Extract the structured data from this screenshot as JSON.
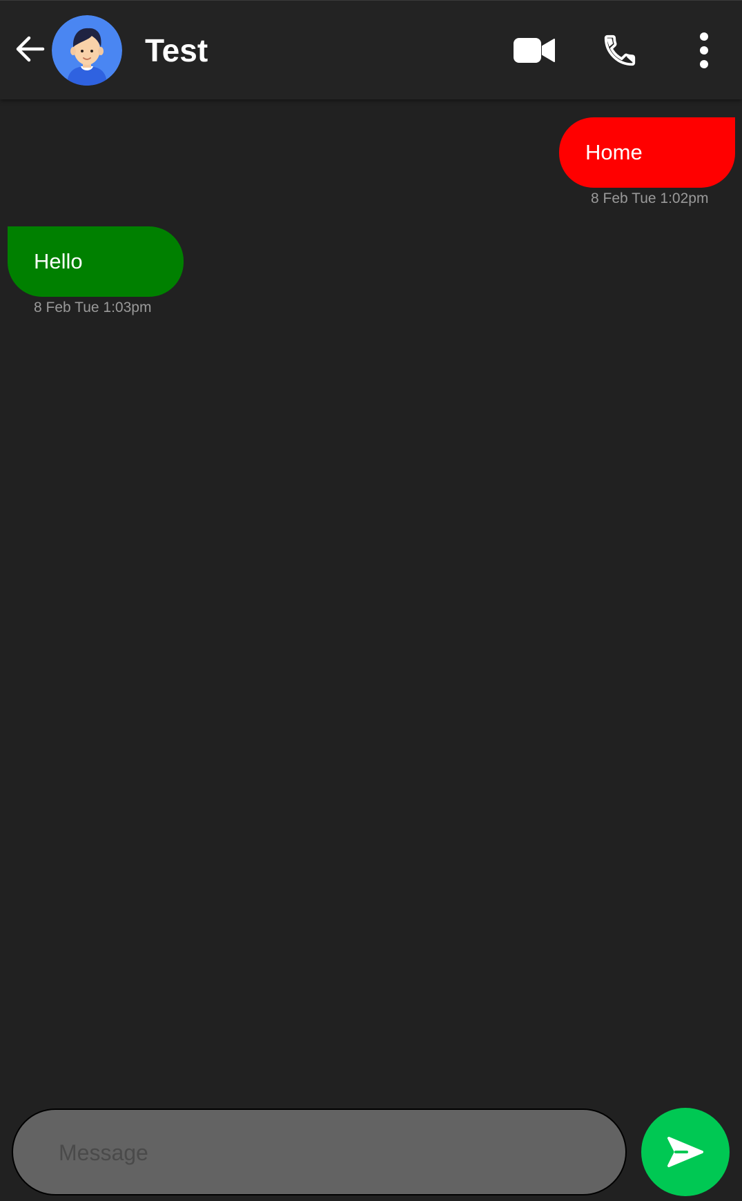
{
  "header": {
    "contact_name": "Test",
    "icons": {
      "back": "arrow-left-icon",
      "avatar": "user-avatar",
      "video": "video-camera-icon",
      "call": "phone-icon",
      "more": "more-vertical-icon"
    }
  },
  "messages": [
    {
      "direction": "outgoing",
      "text": "Home",
      "timestamp": "8 Feb Tue 1:02pm",
      "color": "#ff0000"
    },
    {
      "direction": "incoming",
      "text": "Hello",
      "timestamp": "8 Feb Tue 1:03pm",
      "color": "#008000"
    }
  ],
  "composer": {
    "value": "",
    "placeholder": "Message",
    "send_icon": "send-icon",
    "send_color": "#00c853"
  },
  "theme": {
    "background": "#212121",
    "app_bar": "#232323"
  }
}
